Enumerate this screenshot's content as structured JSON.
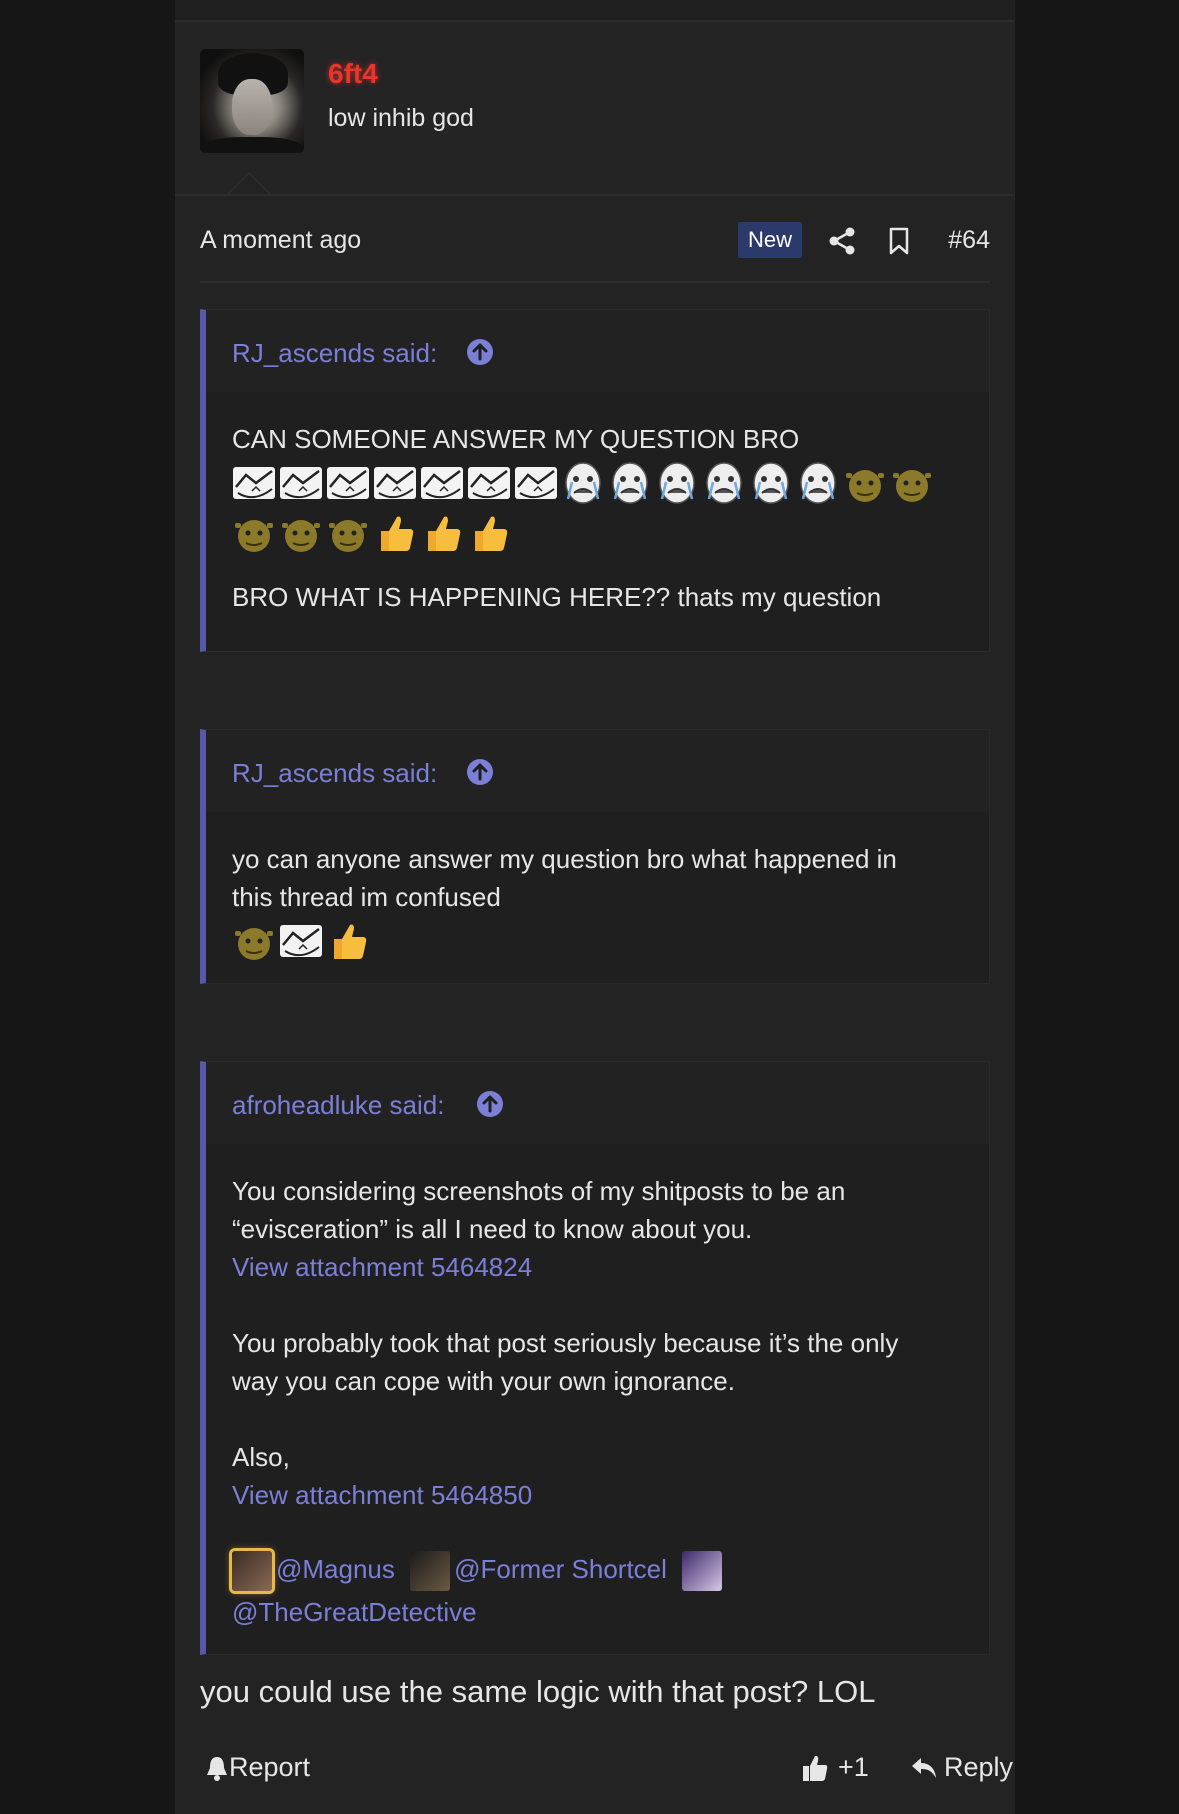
{
  "post": {
    "author": "6ft4",
    "user_title": "low inhib god",
    "timestamp": "A moment ago",
    "badge": "New",
    "number": "#64",
    "reply_text": "you could use the same logic with that post? LOL"
  },
  "quotes": [
    {
      "author_label": "RJ_ascends said:",
      "line1": "CAN SOMEONE ANSWER MY QUESTION BRO",
      "emojis_row1": [
        "troll-face",
        "troll-face",
        "troll-face",
        "troll-face",
        "troll-face",
        "troll-face",
        "troll-face",
        "crying-face",
        "crying-face",
        "crying-face",
        "crying-face",
        "crying-face",
        "crying-face",
        "shrek-face",
        "shrek-face"
      ],
      "emojis_row2": [
        "shrek-face",
        "shrek-face",
        "shrek-face",
        "thumbs-up",
        "thumbs-up",
        "thumbs-up"
      ],
      "line2": "BRO WHAT IS HAPPENING HERE?? thats my question"
    },
    {
      "author_label": "RJ_ascends said:",
      "line1": "yo can anyone answer my question bro what happened in",
      "line2": "this thread im confused",
      "emojis_row1": [
        "shrek-face",
        "troll-face",
        "thumbs-up"
      ]
    },
    {
      "author_label": "afroheadluke said:",
      "para1_line1": "You considering screenshots of my shitposts to be an",
      "para1_line2": "“evisceration” is all I need to know about you.",
      "attachment1": "View attachment 5464824",
      "para2_line1": "You probably took that post seriously because it’s the only",
      "para2_line2": "way you can cope with your own ignorance.",
      "para3": "Also,",
      "attachment2": "View attachment 5464850",
      "mention1": "@Magnus",
      "mention2": "@Former Shortcel",
      "mention3": "@TheGreatDetective"
    }
  ],
  "footer": {
    "report": "Report",
    "like_count": "+1",
    "reply": "Reply"
  },
  "colors": {
    "username": "#e8362b",
    "link": "#7b7fd6",
    "quote_bar": "#5658a8",
    "badge_bg": "#2b3a6b"
  }
}
